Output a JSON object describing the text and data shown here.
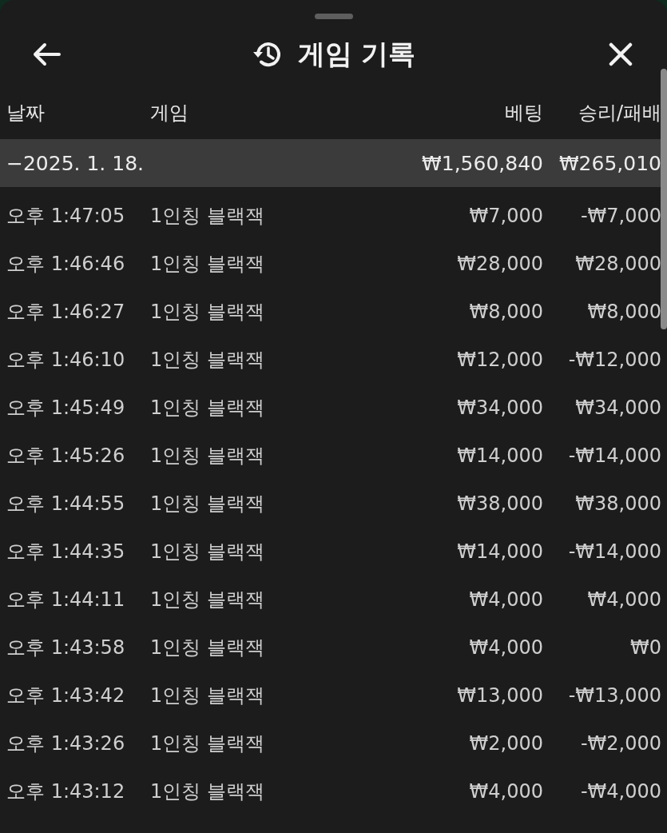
{
  "header": {
    "title": "게임 기록"
  },
  "table": {
    "columns": [
      "날짜",
      "게임",
      "베팅",
      "승리/패배"
    ],
    "group": {
      "label": "−2025. 1. 18.",
      "bet": "₩1,560,840",
      "result": "₩265,010"
    },
    "rows": [
      {
        "time": "오후 1:47:05",
        "game": "1인칭 블랙잭",
        "bet": "₩7,000",
        "result": "-₩7,000"
      },
      {
        "time": "오후 1:46:46",
        "game": "1인칭 블랙잭",
        "bet": "₩28,000",
        "result": "₩28,000"
      },
      {
        "time": "오후 1:46:27",
        "game": "1인칭 블랙잭",
        "bet": "₩8,000",
        "result": "₩8,000"
      },
      {
        "time": "오후 1:46:10",
        "game": "1인칭 블랙잭",
        "bet": "₩12,000",
        "result": "-₩12,000"
      },
      {
        "time": "오후 1:45:49",
        "game": "1인칭 블랙잭",
        "bet": "₩34,000",
        "result": "₩34,000"
      },
      {
        "time": "오후 1:45:26",
        "game": "1인칭 블랙잭",
        "bet": "₩14,000",
        "result": "-₩14,000"
      },
      {
        "time": "오후 1:44:55",
        "game": "1인칭 블랙잭",
        "bet": "₩38,000",
        "result": "₩38,000"
      },
      {
        "time": "오후 1:44:35",
        "game": "1인칭 블랙잭",
        "bet": "₩14,000",
        "result": "-₩14,000"
      },
      {
        "time": "오후 1:44:11",
        "game": "1인칭 블랙잭",
        "bet": "₩4,000",
        "result": "₩4,000"
      },
      {
        "time": "오후 1:43:58",
        "game": "1인칭 블랙잭",
        "bet": "₩4,000",
        "result": "₩0"
      },
      {
        "time": "오후 1:43:42",
        "game": "1인칭 블랙잭",
        "bet": "₩13,000",
        "result": "-₩13,000"
      },
      {
        "time": "오후 1:43:26",
        "game": "1인칭 블랙잭",
        "bet": "₩2,000",
        "result": "-₩2,000"
      },
      {
        "time": "오후 1:43:12",
        "game": "1인칭 블랙잭",
        "bet": "₩4,000",
        "result": "-₩4,000"
      }
    ]
  }
}
